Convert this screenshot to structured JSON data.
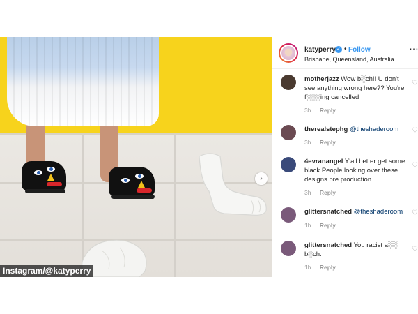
{
  "post": {
    "photo": {
      "credit": "Instagram/@katyperry",
      "colors": {
        "wall": "#f7d31c",
        "floor": "#e6e3de",
        "shoe": "#111111"
      }
    },
    "header": {
      "username": "katyperry",
      "verified_icon": "check-badge-icon",
      "separator": "•",
      "follow_label": "Follow",
      "location": "Brisbane, Queensland, Australia"
    },
    "comments": [
      {
        "username": "motherjazz",
        "text": "Wow b░ch!! U don't see anything wrong here?? You're f░░░ing cancelled",
        "time": "3h",
        "reply": "Reply",
        "avatar_color": "#4a3a30"
      },
      {
        "username": "therealstephg",
        "mention": "@theshaderoom",
        "text": "",
        "time": "3h",
        "reply": "Reply",
        "avatar_color": "#6b4a52"
      },
      {
        "username": "4evranangel",
        "text": "Y'all better get some black People looking over these designs pre production",
        "time": "3h",
        "reply": "Reply",
        "avatar_color": "#3a4a7a"
      },
      {
        "username": "glittersnatched",
        "mention": "@theshaderoom",
        "text": "",
        "time": "1h",
        "reply": "Reply",
        "avatar_color": "#7a5a7a"
      },
      {
        "username": "glittersnatched",
        "text": "You racist a░░ b░ch.",
        "time": "1h",
        "reply": "Reply",
        "avatar_color": "#7a5a7a"
      }
    ],
    "icons": {
      "more": "more-dots-icon",
      "like": "heart-icon",
      "next": "chevron-right-icon"
    },
    "accent": "#3897f0"
  }
}
